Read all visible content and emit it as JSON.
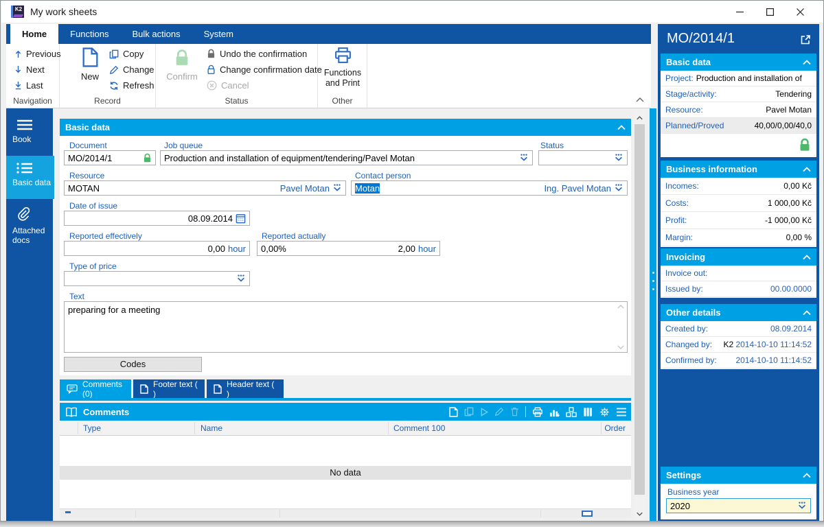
{
  "window": {
    "title": "My work sheets",
    "logo_text": "K2"
  },
  "ribbon": {
    "tabs": [
      {
        "label": "Home"
      },
      {
        "label": "Functions"
      },
      {
        "label": "Bulk actions"
      },
      {
        "label": "System"
      }
    ],
    "navigation": {
      "label": "Navigation",
      "prev": "Previous",
      "next": "Next",
      "last": "Last"
    },
    "record": {
      "label": "Record",
      "new": "New",
      "copy": "Copy",
      "change": "Change",
      "refresh": "Refresh"
    },
    "status": {
      "label": "Status",
      "confirm": "Confirm",
      "undo": "Undo the confirmation",
      "change_date": "Change confirmation date",
      "cancel": "Cancel"
    },
    "other": {
      "label": "Other",
      "functions_print": "Functions and Print"
    }
  },
  "sidebar": {
    "items": [
      {
        "label": "Book"
      },
      {
        "label": "Basic data"
      },
      {
        "label": "Attached docs"
      }
    ]
  },
  "form": {
    "section_title": "Basic data",
    "document": {
      "label": "Document",
      "value": "MO/2014/1"
    },
    "job_queue": {
      "label": "Job queue",
      "value": "Production and installation of equipment/tendering/Pavel Motan"
    },
    "status": {
      "label": "Status",
      "value": ""
    },
    "resource": {
      "label": "Resource",
      "value": "MOTAN",
      "display": "Pavel Motan"
    },
    "contact": {
      "label": "Contact person",
      "value": "Motan",
      "display": "Ing. Pavel Motan"
    },
    "date_of_issue": {
      "label": "Date of issue",
      "value": "08.09.2014"
    },
    "reported_effectively": {
      "label": "Reported effectively",
      "value": "0,00",
      "unit": "hour"
    },
    "reported_actually": {
      "label": "Reported actually",
      "percent": "0,00%",
      "value": "2,00",
      "unit": "hour"
    },
    "type_of_price": {
      "label": "Type of price",
      "value": ""
    },
    "text": {
      "label": "Text",
      "value": "preparing for a meeting"
    },
    "codes_label": "Codes",
    "tabs": [
      {
        "label": "Comments (0)"
      },
      {
        "label": "Footer text ( )"
      },
      {
        "label": "Header text ( )"
      }
    ],
    "comments": {
      "title": "Comments",
      "columns": [
        "Type",
        "Name",
        "Comment 100",
        "Order"
      ],
      "no_data": "No data"
    }
  },
  "panel": {
    "title": "MO/2014/1",
    "sections": {
      "basic": {
        "title": "Basic data",
        "rows": [
          {
            "label": "Project:",
            "value": "Production and installation of"
          },
          {
            "label": "Stage/activity:",
            "value": "Tendering"
          },
          {
            "label": "Resource:",
            "value": "Pavel Motan"
          },
          {
            "label": "Planned/Proved",
            "value": "40,00/0,00/40,0"
          }
        ]
      },
      "business": {
        "title": "Business information",
        "rows": [
          {
            "label": "Incomes:",
            "value": "0,00 Kč"
          },
          {
            "label": "Costs:",
            "value": "1 000,00 Kč"
          },
          {
            "label": "Profit:",
            "value": "-1 000,00 Kč"
          },
          {
            "label": "Margin:",
            "value": "0,00 %"
          }
        ]
      },
      "invoicing": {
        "title": "Invoicing",
        "rows": [
          {
            "label": "Invoice out:",
            "value": ""
          },
          {
            "label": "Issued by:",
            "value": "00.00.0000"
          }
        ]
      },
      "other": {
        "title": "Other details",
        "rows": [
          {
            "label": "Created by:",
            "prefix": "",
            "value": "08.09.2014"
          },
          {
            "label": "Changed by:",
            "prefix": "K2 ",
            "value": "2014-10-10 11:14:52"
          },
          {
            "label": "Confirmed by:",
            "prefix": "",
            "value": "2014-10-10 11:14:52"
          }
        ]
      },
      "settings": {
        "title": "Settings",
        "field_label": "Business year",
        "field_value": "2020"
      }
    }
  },
  "colors": {
    "dark_blue": "#0f55a4",
    "cyan": "#00a1e4",
    "label_blue": "#1d5fb8",
    "green_lock": "#4db86a",
    "selection": "#0078d7",
    "cream": "#fcf7d5"
  }
}
